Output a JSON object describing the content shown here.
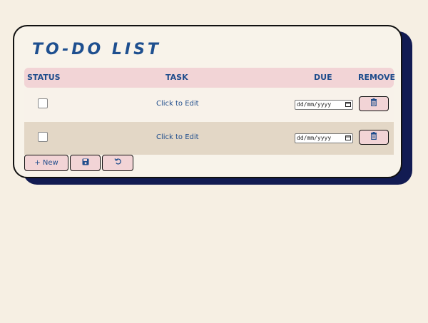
{
  "app": {
    "title": "TO-DO LIST"
  },
  "table": {
    "headers": {
      "status": "STATUS",
      "task": "TASK",
      "due": "DUE",
      "remove": "REMOVE"
    },
    "rows": [
      {
        "checked": false,
        "task": "Click to Edit",
        "due_placeholder": "dd/mm/yyyy"
      },
      {
        "checked": false,
        "task": "Click to Edit",
        "due_placeholder": "dd/mm/yyyy"
      }
    ]
  },
  "toolbar": {
    "new_label": "+ New",
    "save_icon": "floppy-disk-icon",
    "reset_icon": "undo-icon",
    "remove_icon": "trash-icon"
  },
  "colors": {
    "background": "#f6efe3",
    "card": "#f8f3ea",
    "shadow": "#121b52",
    "header": "#f2d4d6",
    "accent_text": "#1e4f8f",
    "alt_row": "#e3d7c6"
  }
}
